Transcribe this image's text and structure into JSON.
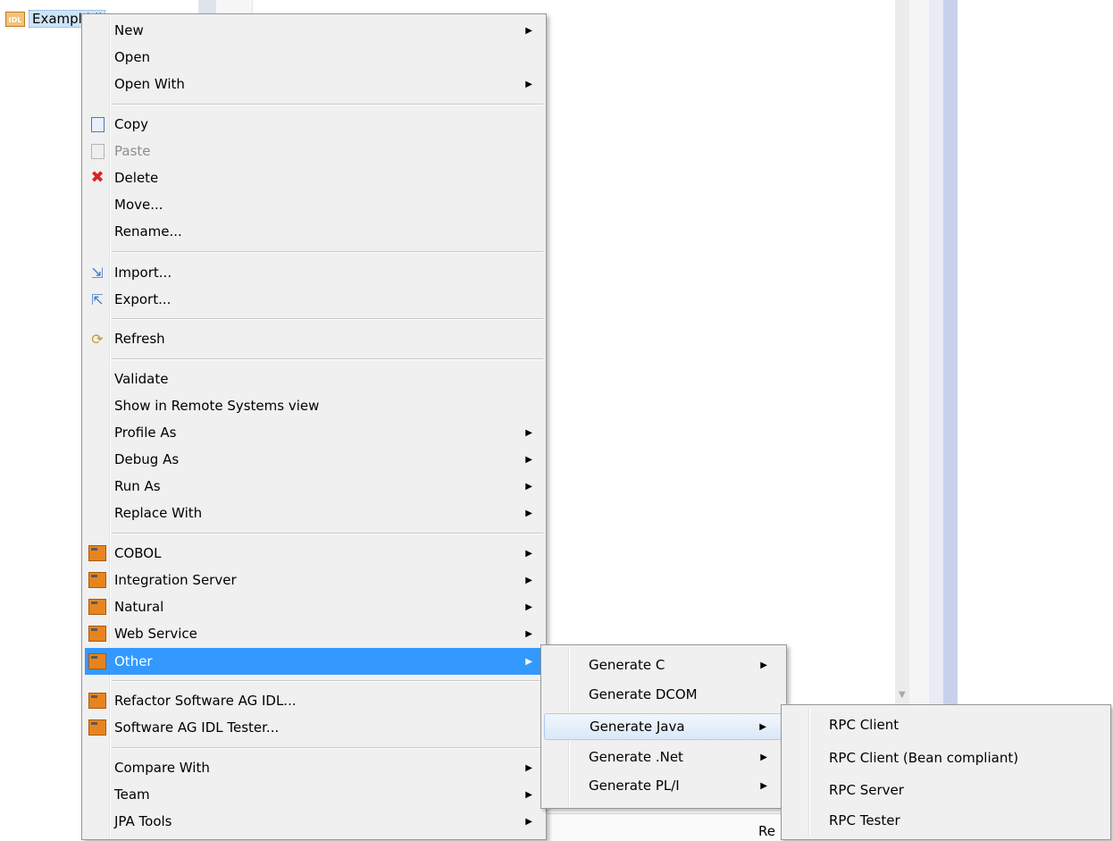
{
  "tree": {
    "file_label": "Exampl.idl",
    "file_icon": "idl-file-icon"
  },
  "background": {
    "bottom_text": "Re"
  },
  "main_menu": {
    "items": [
      {
        "label": "New",
        "submenu": true
      },
      {
        "label": "Open"
      },
      {
        "label": "Open With",
        "submenu": true
      },
      {
        "label": "Copy",
        "icon": "copy-icon"
      },
      {
        "label": "Paste",
        "icon": "paste-icon",
        "disabled": true
      },
      {
        "label": "Delete",
        "icon": "delete-icon"
      },
      {
        "label": "Move..."
      },
      {
        "label": "Rename..."
      },
      {
        "label": "Import...",
        "icon": "import-icon"
      },
      {
        "label": "Export...",
        "icon": "export-icon"
      },
      {
        "label": "Refresh",
        "icon": "refresh-icon"
      },
      {
        "label": "Validate"
      },
      {
        "label": "Show in Remote Systems view"
      },
      {
        "label": "Profile As",
        "submenu": true
      },
      {
        "label": "Debug As",
        "submenu": true
      },
      {
        "label": "Run As",
        "submenu": true
      },
      {
        "label": "Replace With",
        "submenu": true
      },
      {
        "label": "COBOL",
        "icon": "cobol-icon",
        "submenu": true
      },
      {
        "label": "Integration Server",
        "icon": "integration-server-icon",
        "submenu": true
      },
      {
        "label": "Natural",
        "icon": "natural-icon",
        "submenu": true
      },
      {
        "label": "Web Service",
        "icon": "web-service-icon",
        "submenu": true
      },
      {
        "label": "Other",
        "icon": "other-icon",
        "submenu": true,
        "highlighted": true
      },
      {
        "label": "Refactor Software AG IDL...",
        "icon": "refactor-icon"
      },
      {
        "label": "Software AG IDL Tester...",
        "icon": "tester-icon"
      },
      {
        "label": "Compare With",
        "submenu": true
      },
      {
        "label": "Team",
        "submenu": true
      },
      {
        "label": "JPA Tools",
        "submenu": true
      }
    ]
  },
  "other_submenu": {
    "items": [
      {
        "label": "Generate C",
        "submenu": true
      },
      {
        "label": "Generate DCOM"
      },
      {
        "label": "Generate Java",
        "submenu": true,
        "highlighted": true
      },
      {
        "label": "Generate .Net",
        "submenu": true
      },
      {
        "label": "Generate PL/I",
        "submenu": true
      }
    ]
  },
  "java_submenu": {
    "items": [
      {
        "label": "RPC Client"
      },
      {
        "label": "RPC Client (Bean compliant)"
      },
      {
        "label": "RPC Server"
      },
      {
        "label": "RPC Tester"
      }
    ]
  }
}
